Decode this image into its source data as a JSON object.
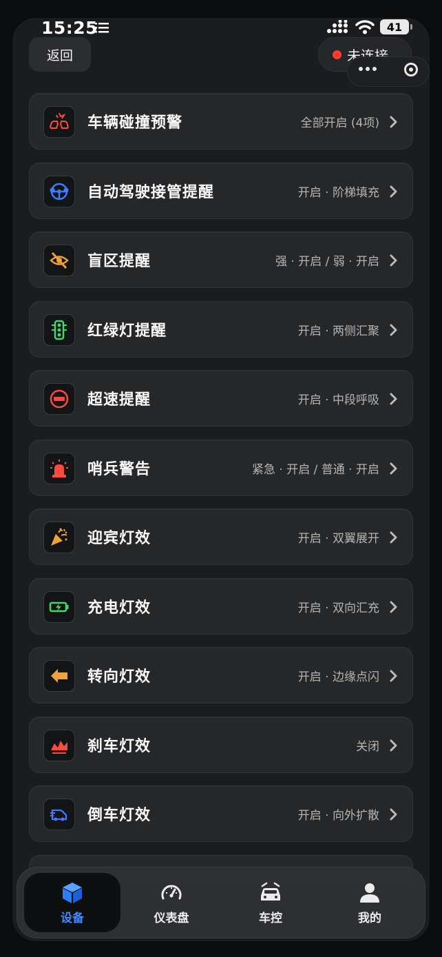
{
  "status_bar": {
    "time": "15:25",
    "battery": "41"
  },
  "header": {
    "back_label": "返回",
    "connection_label": "未连接"
  },
  "items": [
    {
      "title": "车辆碰撞预警",
      "value": "全部开启 (4项)",
      "icon": "collision-warning-icon",
      "icon_color": "#ff4a3d"
    },
    {
      "title": "自动驾驶接管提醒",
      "value": "开启 · 阶梯填充",
      "icon": "steering-wheel-hands-icon",
      "icon_color": "#3d7bff"
    },
    {
      "title": "盲区提醒",
      "value": "强 · 开启 / 弱 · 开启",
      "icon": "eye-slash-icon",
      "icon_color": "#f0a23a"
    },
    {
      "title": "红绿灯提醒",
      "value": "开启 · 两侧汇聚",
      "icon": "traffic-light-icon",
      "icon_color": "#42d86b"
    },
    {
      "title": "超速提醒",
      "value": "开启 · 中段呼吸",
      "icon": "no-entry-icon",
      "icon_color": "#ff4a3d"
    },
    {
      "title": "哨兵警告",
      "value": "紧急 · 开启 / 普通 · 开启",
      "icon": "siren-icon",
      "icon_color": "#ff4a3d"
    },
    {
      "title": "迎宾灯效",
      "value": "开启 · 双翼展开",
      "icon": "party-popper-icon",
      "icon_color": "#f0a23a"
    },
    {
      "title": "充电灯效",
      "value": "开启 · 双向汇充",
      "icon": "battery-charging-icon",
      "icon_color": "#42d86b"
    },
    {
      "title": "转向灯效",
      "value": "开启 · 边缘点闪",
      "icon": "arrow-left-icon",
      "icon_color": "#f0a23a"
    },
    {
      "title": "刹车灯效",
      "value": "关闭",
      "icon": "brake-light-icon",
      "icon_color": "#ff4a3d"
    },
    {
      "title": "倒车灯效",
      "value": "开启 · 向外扩散",
      "icon": "reverse-car-icon",
      "icon_color": "#3d7bff"
    }
  ],
  "tabs": [
    {
      "label": "设备",
      "icon": "cube-icon",
      "active": true
    },
    {
      "label": "仪表盘",
      "icon": "speedometer-icon",
      "active": false
    },
    {
      "label": "车控",
      "icon": "car-icon",
      "active": false
    },
    {
      "label": "我的",
      "icon": "person-icon",
      "active": false
    }
  ],
  "colors": {
    "accent": "#3d8bff",
    "row_bg": "#262729",
    "page_bg": "#1b1c1e",
    "status_dot": "#ff3b30"
  }
}
